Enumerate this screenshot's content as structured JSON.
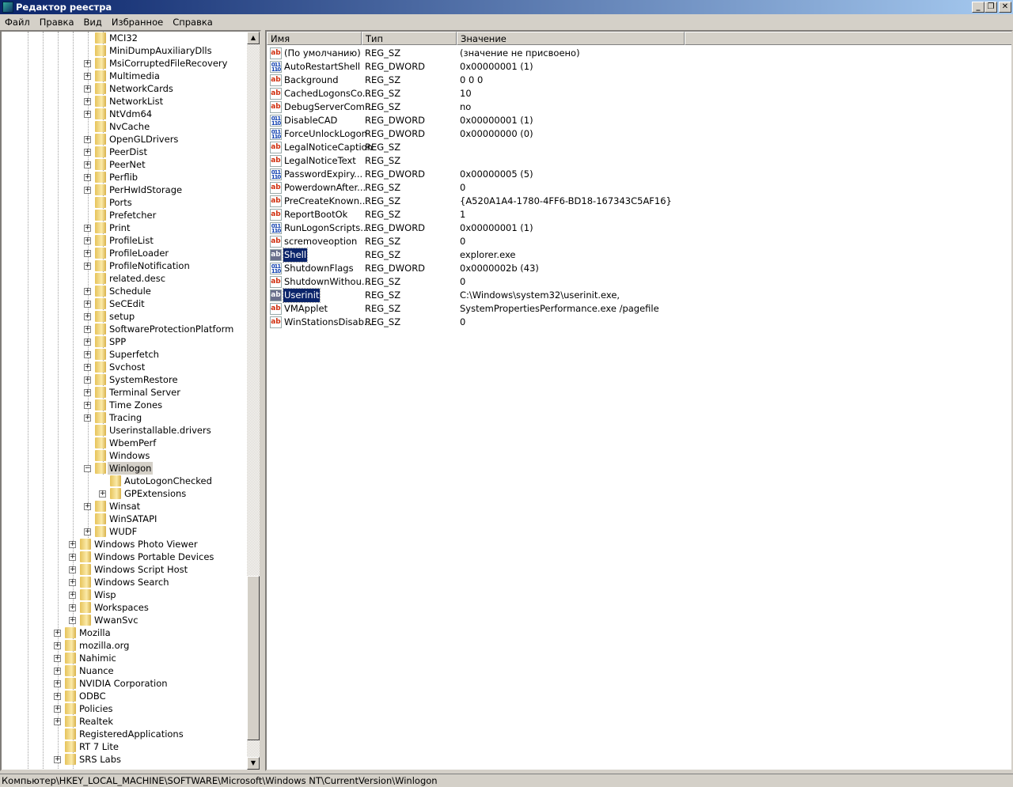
{
  "window": {
    "title": "Редактор реестра",
    "min": "_",
    "max": "❐",
    "close": "✕"
  },
  "menu": [
    "Файл",
    "Правка",
    "Вид",
    "Избранное",
    "Справка"
  ],
  "tree": [
    {
      "label": "MCI32",
      "level": 2,
      "exp": ""
    },
    {
      "label": "MiniDumpAuxiliaryDlls",
      "level": 2,
      "exp": ""
    },
    {
      "label": "MsiCorruptedFileRecovery",
      "level": 2,
      "exp": "+"
    },
    {
      "label": "Multimedia",
      "level": 2,
      "exp": "+"
    },
    {
      "label": "NetworkCards",
      "level": 2,
      "exp": "+"
    },
    {
      "label": "NetworkList",
      "level": 2,
      "exp": "+"
    },
    {
      "label": "NtVdm64",
      "level": 2,
      "exp": "+"
    },
    {
      "label": "NvCache",
      "level": 2,
      "exp": ""
    },
    {
      "label": "OpenGLDrivers",
      "level": 2,
      "exp": "+"
    },
    {
      "label": "PeerDist",
      "level": 2,
      "exp": "+"
    },
    {
      "label": "PeerNet",
      "level": 2,
      "exp": "+"
    },
    {
      "label": "Perflib",
      "level": 2,
      "exp": "+"
    },
    {
      "label": "PerHwIdStorage",
      "level": 2,
      "exp": "+"
    },
    {
      "label": "Ports",
      "level": 2,
      "exp": ""
    },
    {
      "label": "Prefetcher",
      "level": 2,
      "exp": ""
    },
    {
      "label": "Print",
      "level": 2,
      "exp": "+"
    },
    {
      "label": "ProfileList",
      "level": 2,
      "exp": "+"
    },
    {
      "label": "ProfileLoader",
      "level": 2,
      "exp": "+"
    },
    {
      "label": "ProfileNotification",
      "level": 2,
      "exp": "+"
    },
    {
      "label": "related.desc",
      "level": 2,
      "exp": ""
    },
    {
      "label": "Schedule",
      "level": 2,
      "exp": "+"
    },
    {
      "label": "SeCEdit",
      "level": 2,
      "exp": "+"
    },
    {
      "label": "setup",
      "level": 2,
      "exp": "+"
    },
    {
      "label": "SoftwareProtectionPlatform",
      "level": 2,
      "exp": "+"
    },
    {
      "label": "SPP",
      "level": 2,
      "exp": "+"
    },
    {
      "label": "Superfetch",
      "level": 2,
      "exp": "+"
    },
    {
      "label": "Svchost",
      "level": 2,
      "exp": "+"
    },
    {
      "label": "SystemRestore",
      "level": 2,
      "exp": "+"
    },
    {
      "label": "Terminal Server",
      "level": 2,
      "exp": "+"
    },
    {
      "label": "Time Zones",
      "level": 2,
      "exp": "+"
    },
    {
      "label": "Tracing",
      "level": 2,
      "exp": "+"
    },
    {
      "label": "Userinstallable.drivers",
      "level": 2,
      "exp": ""
    },
    {
      "label": "WbemPerf",
      "level": 2,
      "exp": ""
    },
    {
      "label": "Windows",
      "level": 2,
      "exp": ""
    },
    {
      "label": "Winlogon",
      "level": 2,
      "exp": "−",
      "selected": true
    },
    {
      "label": "AutoLogonChecked",
      "level": 3,
      "exp": ""
    },
    {
      "label": "GPExtensions",
      "level": 3,
      "exp": "+"
    },
    {
      "label": "Winsat",
      "level": 2,
      "exp": "+"
    },
    {
      "label": "WinSATAPI",
      "level": 2,
      "exp": ""
    },
    {
      "label": "WUDF",
      "level": 2,
      "exp": "+"
    },
    {
      "label": "Windows Photo Viewer",
      "level": 1,
      "exp": "+"
    },
    {
      "label": "Windows Portable Devices",
      "level": 1,
      "exp": "+"
    },
    {
      "label": "Windows Script Host",
      "level": 1,
      "exp": "+"
    },
    {
      "label": "Windows Search",
      "level": 1,
      "exp": "+"
    },
    {
      "label": "Wisp",
      "level": 1,
      "exp": "+"
    },
    {
      "label": "Workspaces",
      "level": 1,
      "exp": "+"
    },
    {
      "label": "WwanSvc",
      "level": 1,
      "exp": "+"
    },
    {
      "label": "Mozilla",
      "level": 0,
      "exp": "+"
    },
    {
      "label": "mozilla.org",
      "level": 0,
      "exp": "+"
    },
    {
      "label": "Nahimic",
      "level": 0,
      "exp": "+"
    },
    {
      "label": "Nuance",
      "level": 0,
      "exp": "+"
    },
    {
      "label": "NVIDIA Corporation",
      "level": 0,
      "exp": "+"
    },
    {
      "label": "ODBC",
      "level": 0,
      "exp": "+"
    },
    {
      "label": "Policies",
      "level": 0,
      "exp": "+"
    },
    {
      "label": "Realtek",
      "level": 0,
      "exp": "+"
    },
    {
      "label": "RegisteredApplications",
      "level": 0,
      "exp": ""
    },
    {
      "label": "RT 7 Lite",
      "level": 0,
      "exp": ""
    },
    {
      "label": "SRS Labs",
      "level": 0,
      "exp": "+"
    }
  ],
  "list": {
    "headers": [
      "Имя",
      "Тип",
      "Значение"
    ],
    "rows": [
      {
        "name": "(По умолчанию)",
        "type": "REG_SZ",
        "value": "(значение не присвоено)",
        "icon": "ab"
      },
      {
        "name": "AutoRestartShell",
        "type": "REG_DWORD",
        "value": "0x00000001 (1)",
        "icon": "bin"
      },
      {
        "name": "Background",
        "type": "REG_SZ",
        "value": "0 0 0",
        "icon": "ab"
      },
      {
        "name": "CachedLogonsCo...",
        "type": "REG_SZ",
        "value": "10",
        "icon": "ab"
      },
      {
        "name": "DebugServerCom...",
        "type": "REG_SZ",
        "value": "no",
        "icon": "ab"
      },
      {
        "name": "DisableCAD",
        "type": "REG_DWORD",
        "value": "0x00000001 (1)",
        "icon": "bin"
      },
      {
        "name": "ForceUnlockLogon",
        "type": "REG_DWORD",
        "value": "0x00000000 (0)",
        "icon": "bin"
      },
      {
        "name": "LegalNoticeCaption",
        "type": "REG_SZ",
        "value": "",
        "icon": "ab"
      },
      {
        "name": "LegalNoticeText",
        "type": "REG_SZ",
        "value": "",
        "icon": "ab"
      },
      {
        "name": "PasswordExpiry...",
        "type": "REG_DWORD",
        "value": "0x00000005 (5)",
        "icon": "bin"
      },
      {
        "name": "PowerdownAfter...",
        "type": "REG_SZ",
        "value": "0",
        "icon": "ab"
      },
      {
        "name": "PreCreateKnown...",
        "type": "REG_SZ",
        "value": "{A520A1A4-1780-4FF6-BD18-167343C5AF16}",
        "icon": "ab"
      },
      {
        "name": "ReportBootOk",
        "type": "REG_SZ",
        "value": "1",
        "icon": "ab"
      },
      {
        "name": "RunLogonScripts...",
        "type": "REG_DWORD",
        "value": "0x00000001 (1)",
        "icon": "bin"
      },
      {
        "name": "scremoveoption",
        "type": "REG_SZ",
        "value": "0",
        "icon": "ab"
      },
      {
        "name": "Shell",
        "type": "REG_SZ",
        "value": "explorer.exe",
        "icon": "ab",
        "selected": true
      },
      {
        "name": "ShutdownFlags",
        "type": "REG_DWORD",
        "value": "0x0000002b (43)",
        "icon": "bin"
      },
      {
        "name": "ShutdownWithou...",
        "type": "REG_SZ",
        "value": "0",
        "icon": "ab"
      },
      {
        "name": "Userinit",
        "type": "REG_SZ",
        "value": "C:\\Windows\\system32\\userinit.exe,",
        "icon": "ab",
        "selected": true
      },
      {
        "name": "VMApplet",
        "type": "REG_SZ",
        "value": "SystemPropertiesPerformance.exe /pagefile",
        "icon": "ab"
      },
      {
        "name": "WinStationsDisab...",
        "type": "REG_SZ",
        "value": "0",
        "icon": "ab"
      }
    ]
  },
  "status": "Компьютер\\HKEY_LOCAL_MACHINE\\SOFTWARE\\Microsoft\\Windows NT\\CurrentVersion\\Winlogon"
}
